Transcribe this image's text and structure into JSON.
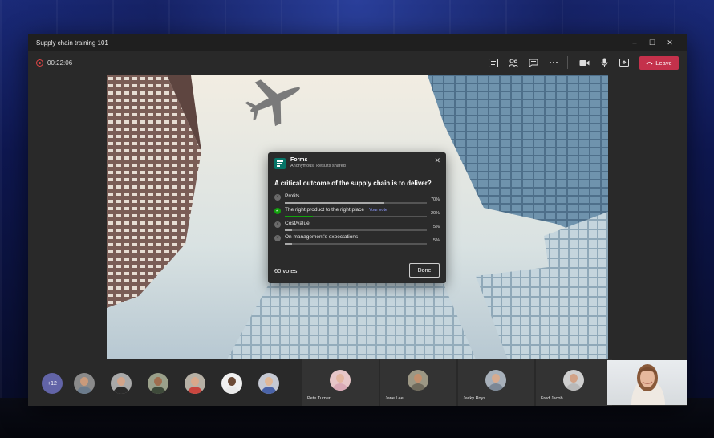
{
  "window": {
    "title": "Supply chain training 101",
    "controls": [
      "–",
      "☐",
      "✕"
    ]
  },
  "toolbar": {
    "timer": "00:22:06",
    "icons": [
      "forms-icon",
      "participants-icon",
      "chat-icon",
      "more-options-icon",
      "camera-icon",
      "microphone-icon",
      "share-screen-icon"
    ],
    "leave_label": "Leave"
  },
  "poll": {
    "app_name": "Forms",
    "subtitle": "Anonymous; Results shared",
    "question": "A critical outcome of the supply chain is to deliver?",
    "options": [
      {
        "label": "Profits",
        "percent": "70%",
        "fraction": 0.7,
        "selected": false,
        "tag": ""
      },
      {
        "label": "The right product to the right place",
        "percent": "20%",
        "fraction": 0.2,
        "selected": true,
        "tag": "Your vote"
      },
      {
        "label": "Cost/value",
        "percent": "5%",
        "fraction": 0.05,
        "selected": false,
        "tag": ""
      },
      {
        "label": "On management's expectations",
        "percent": "5%",
        "fraction": 0.05,
        "selected": false,
        "tag": ""
      }
    ],
    "votes": "60 votes",
    "done_label": "Done",
    "accent": "#13a10e"
  },
  "participants": {
    "overflow": "+12",
    "named_tiles": [
      "Pete Turner",
      "Jane Lee",
      "Jacky Roys",
      "Fred Jacob"
    ]
  },
  "colors": {
    "leave": "#c4314b",
    "teams_purple": "#6264a7",
    "your_vote": "#8f9bff"
  }
}
